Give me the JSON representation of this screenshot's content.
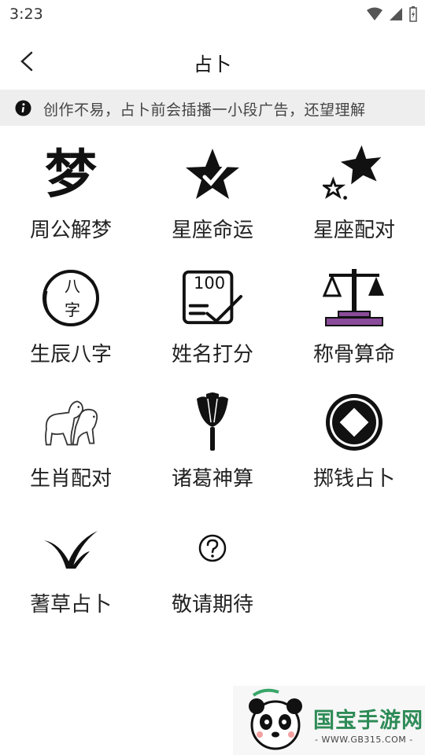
{
  "status_bar": {
    "time": "3:23"
  },
  "header": {
    "title": "占卜"
  },
  "notice": {
    "text": "创作不易，占卜前会插播一小段广告，还望理解"
  },
  "items": [
    {
      "label": "周公解梦",
      "icon": "dream-char-icon",
      "glyph": "梦"
    },
    {
      "label": "星座命运",
      "icon": "star-icon"
    },
    {
      "label": "星座配对",
      "icon": "stars-pair-icon"
    },
    {
      "label": "生辰八字",
      "icon": "bazi-seal-icon",
      "glyph_top": "八",
      "glyph_bottom": "字"
    },
    {
      "label": "姓名打分",
      "icon": "score-card-icon",
      "score": "100"
    },
    {
      "label": "称骨算命",
      "icon": "scale-icon"
    },
    {
      "label": "生肖配对",
      "icon": "zodiac-animals-icon"
    },
    {
      "label": "诸葛神算",
      "icon": "feather-fan-icon"
    },
    {
      "label": "掷钱占卜",
      "icon": "coin-icon"
    },
    {
      "label": "蓍草占卜",
      "icon": "yarrow-grass-icon"
    },
    {
      "label": "敬请期待",
      "icon": "question-icon"
    }
  ],
  "watermark": {
    "name": "国宝手游网",
    "url": "- WWW.GB315.COM -"
  },
  "colors": {
    "accent_purple": "#8a4c9a",
    "notice_bg": "#eeeeee",
    "brand_green": "#2e8b57"
  }
}
